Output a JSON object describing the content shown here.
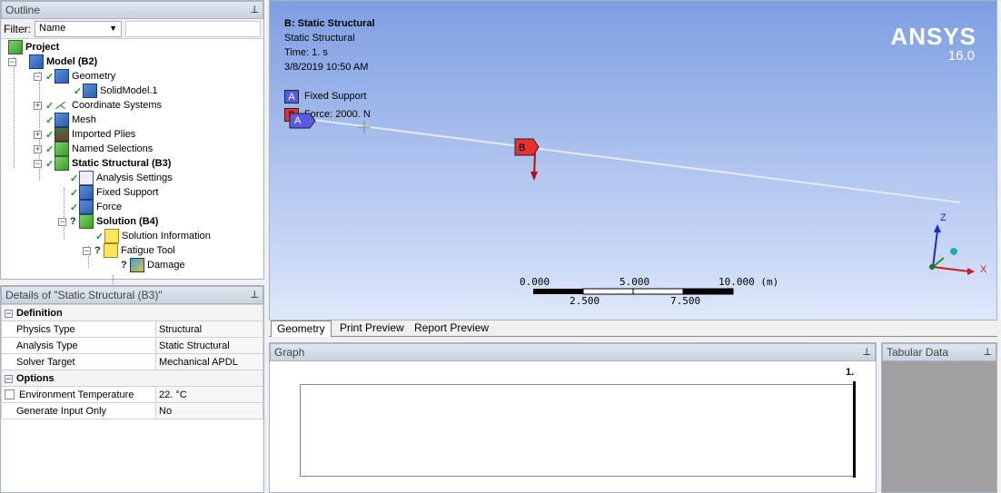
{
  "outline": {
    "title": "Outline",
    "filter_label": "Filter:",
    "filter_value": "Name",
    "tree": [
      {
        "label": "Project",
        "bold": true
      },
      {
        "label": "Model (B2)",
        "bold": true
      },
      {
        "label": "Geometry",
        "bold": false
      },
      {
        "label": "SolidModel.1",
        "bold": false
      },
      {
        "label": "Coordinate Systems",
        "bold": false
      },
      {
        "label": "Mesh",
        "bold": false
      },
      {
        "label": "Imported Plies",
        "bold": false
      },
      {
        "label": "Named Selections",
        "bold": false
      },
      {
        "label": "Static Structural (B3)",
        "bold": true
      },
      {
        "label": "Analysis Settings",
        "bold": false
      },
      {
        "label": "Fixed Support",
        "bold": false
      },
      {
        "label": "Force",
        "bold": false
      },
      {
        "label": "Solution (B4)",
        "bold": true
      },
      {
        "label": "Solution Information",
        "bold": false
      },
      {
        "label": "Fatigue Tool",
        "bold": false
      },
      {
        "label": "Damage",
        "bold": false
      }
    ]
  },
  "details": {
    "title": "Details of \"Static Structural (B3)\"",
    "groups": [
      {
        "name": "Definition",
        "rows": [
          {
            "key": "Physics Type",
            "value": "Structural"
          },
          {
            "key": "Analysis Type",
            "value": "Static Structural"
          },
          {
            "key": "Solver Target",
            "value": "Mechanical APDL"
          }
        ]
      },
      {
        "name": "Options",
        "rows": [
          {
            "key": "Environment Temperature",
            "value": "22. °C"
          },
          {
            "key": "Generate Input Only",
            "value": "No"
          }
        ]
      }
    ]
  },
  "viewport": {
    "header": "B: Static Structural",
    "subtitle": "Static Structural",
    "time": "Time: 1. s",
    "date": "3/8/2019 10:50 AM",
    "legend": [
      {
        "tag": "A",
        "label": "Fixed Support",
        "color": "#5a5ae6"
      },
      {
        "tag": "B",
        "label": "Force: 2000. N",
        "color": "#e83030"
      }
    ],
    "logo": "ANSYS",
    "version": "16.0",
    "scale_top": [
      "0.000",
      "5.000",
      "10.000 (m)"
    ],
    "scale_bottom": [
      "2.500",
      "7.500"
    ],
    "axes": {
      "z": "Z",
      "x": "X"
    },
    "marker_a": "A",
    "marker_b": "B"
  },
  "tabs": [
    "Geometry",
    "Print Preview",
    "Report Preview"
  ],
  "graph": {
    "title": "Graph",
    "value_label": "1."
  },
  "tabular": {
    "title": "Tabular Data"
  },
  "pin_icon": "pin-icon"
}
